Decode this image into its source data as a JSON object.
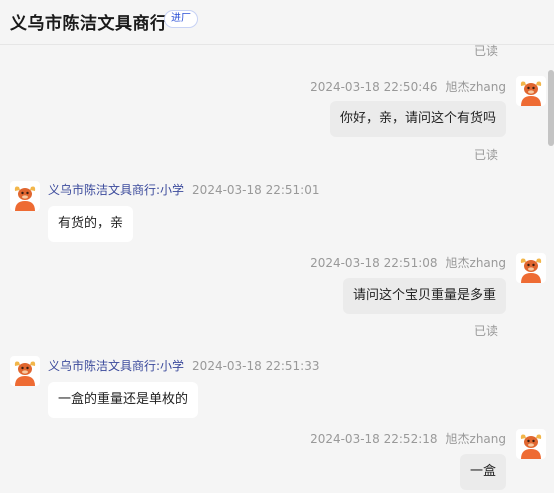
{
  "header": {
    "title": "义乌市陈洁文具商行",
    "badge": "进厂"
  },
  "messages": [
    {
      "direction": "out",
      "time": "2024-03-18 22:50:46",
      "sender": "旭杰zhang",
      "text": "你好，亲，请问这个有货吗",
      "status": "已读"
    },
    {
      "direction": "in",
      "time": "2024-03-18 22:51:01",
      "sender": "义乌市陈洁文具商行:小学",
      "text": "有货的，亲"
    },
    {
      "direction": "out",
      "time": "2024-03-18 22:51:08",
      "sender": "旭杰zhang",
      "text": "请问这个宝贝重量是多重",
      "status": "已读"
    },
    {
      "direction": "in",
      "time": "2024-03-18 22:51:33",
      "sender": "义乌市陈洁文具商行:小学",
      "text": "一盒的重量还是单枚的"
    },
    {
      "direction": "out",
      "time": "2024-03-18 22:52:18",
      "sender": "旭杰zhang",
      "text": "一盒"
    }
  ],
  "top_read_status": "已读",
  "icons": {
    "avatar": "bull-mascot-icon"
  },
  "colors": {
    "background": "#f5f5f5",
    "outgoing_bubble": "#ebebeb",
    "incoming_bubble": "#ffffff",
    "sender_name": "#3b4a9c",
    "badge_text": "#2a4fd6"
  }
}
